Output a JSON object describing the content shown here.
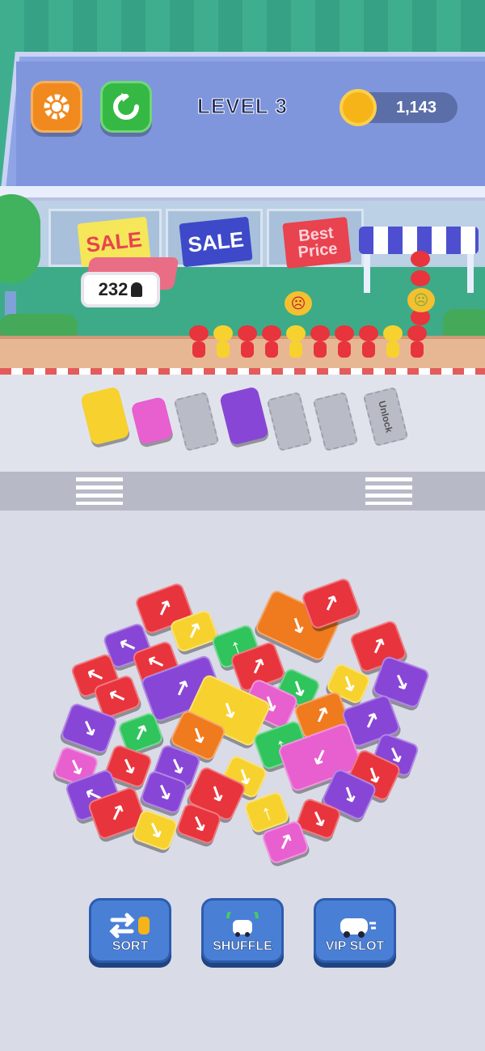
{
  "hud": {
    "level_text": "LEVEL 3",
    "coins": "1,143",
    "settings_icon": "gear-icon",
    "restart_icon": "restart-icon",
    "coin_icon": "coin-car-icon"
  },
  "scene": {
    "sign_sale_1": "SALE",
    "sign_sale_2": "SALE",
    "sign_best_price": "Best Price",
    "queue_count": "232",
    "unlock_label": "Unlock",
    "angry_face_icon": "angry-face-icon",
    "sad_face_icon": "sad-face-icon"
  },
  "powerups": [
    {
      "label": "SORT",
      "icon": "sort-icon"
    },
    {
      "label": "SHUFFLE",
      "icon": "shuffle-icon"
    },
    {
      "label": "VIP SLOT",
      "icon": "vip-car-icon"
    }
  ],
  "colors": {
    "red": "#e8343c",
    "yellow": "#f7d22e",
    "purple": "#8846d6",
    "pink": "#e85fd0",
    "green": "#2fc45c",
    "orange": "#f07a1e",
    "settings_btn": "#f08a1f",
    "restart_btn": "#36b845",
    "button_blue": "#4a7fd6"
  }
}
